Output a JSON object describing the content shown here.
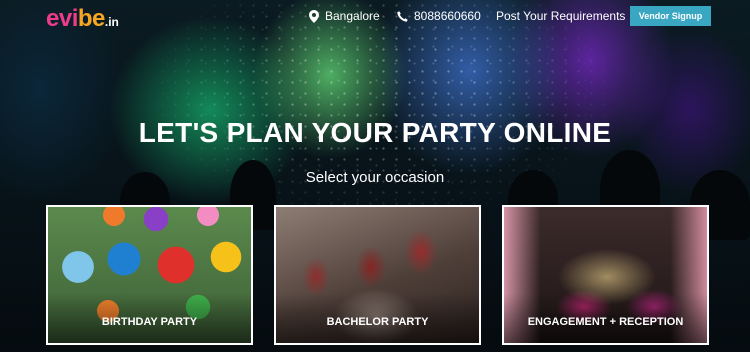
{
  "header": {
    "logo": {
      "main": "evi",
      "accent": "be",
      "suffix": ".in"
    },
    "location": {
      "icon": "location-pin-icon",
      "label": "Bangalore"
    },
    "phone": {
      "icon": "phone-icon",
      "label": "8088660660"
    },
    "post_requirements_label": "Post Your Requirements",
    "vendor_signup_label": "Vendor Signup"
  },
  "hero": {
    "headline": "LET'S PLAN YOUR PARTY ONLINE",
    "subheadline": "Select your occasion"
  },
  "occasions": [
    {
      "label": "BIRTHDAY PARTY"
    },
    {
      "label": "BACHELOR PARTY"
    },
    {
      "label": "ENGAGEMENT + RECEPTION"
    }
  ],
  "colors": {
    "logo_pink": "#ee3c8a",
    "logo_orange": "#f5a623",
    "vendor_button": "#3aa7c2",
    "text": "#ffffff"
  }
}
